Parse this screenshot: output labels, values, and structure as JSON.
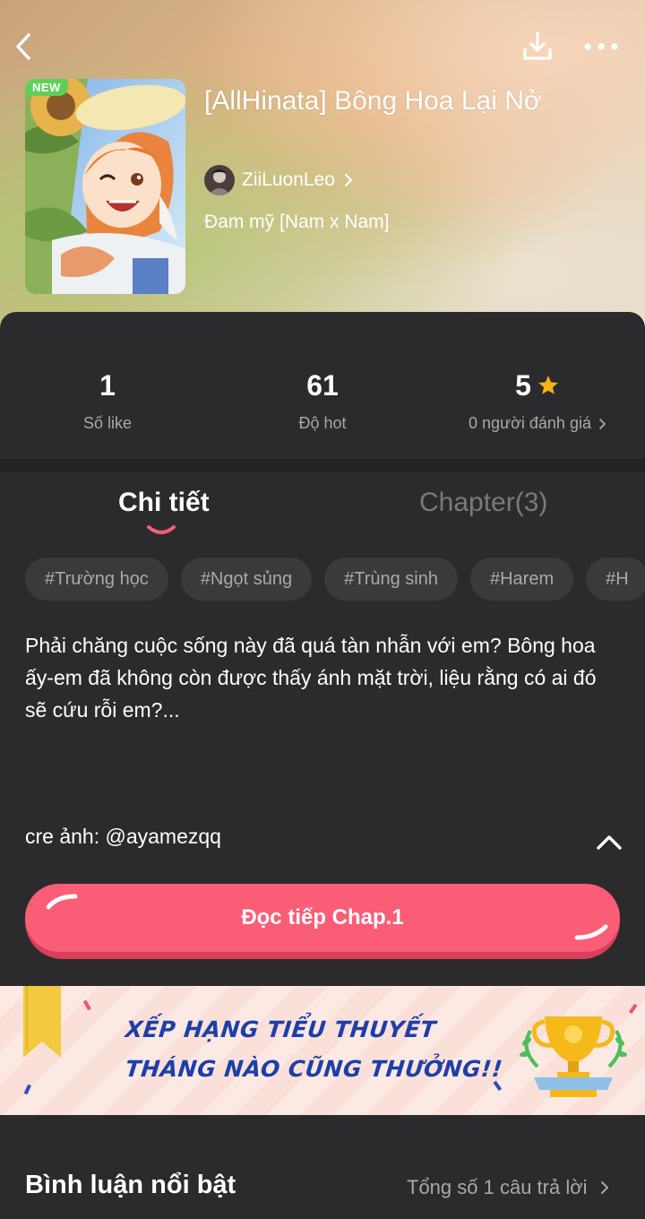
{
  "header": {
    "back_icon": "chevron-left-icon",
    "download_icon": "download-icon",
    "more_icon": "more-horizontal-icon"
  },
  "book": {
    "badge": "NEW",
    "title": "[AllHinata] Bông Hoa Lại Nở",
    "author": "ZiiLuonLeo",
    "genre": "Đam mỹ [Nam x Nam]"
  },
  "stats": [
    {
      "value": "1",
      "label": "Số like"
    },
    {
      "value": "61",
      "label": "Độ hot"
    },
    {
      "value": "5",
      "label": "0 người đánh giá"
    }
  ],
  "tabs": {
    "details": "Chi tiết",
    "chapters": "Chapter(3)"
  },
  "tags": [
    "#Trường học",
    "#Ngọt sủng",
    "#Trùng sinh",
    "#Harem",
    "#H"
  ],
  "description": "Phải chăng cuộc sống này đã quá tàn nhẫn với em? Bông hoa ấy-em đã không còn được thấy ánh mặt trời, liệu rằng có ai đó sẽ cứu rỗi em?...",
  "credit": "cre ảnh: @ayamezqq",
  "read_button": "Đọc tiếp Chap.1",
  "banner": {
    "line1": "XẾP HẠNG TIỂU THUYẾT",
    "line2": "THÁNG NÀO CŨNG THƯỞNG!!"
  },
  "comments": {
    "title": "Bình luận nổi bật",
    "count": "Tổng số 1 câu trả lời"
  },
  "colors": {
    "accent": "#fa5d76",
    "star": "#f6b21b",
    "background": "#2b2b2d",
    "banner_text": "#1d3fa8"
  }
}
